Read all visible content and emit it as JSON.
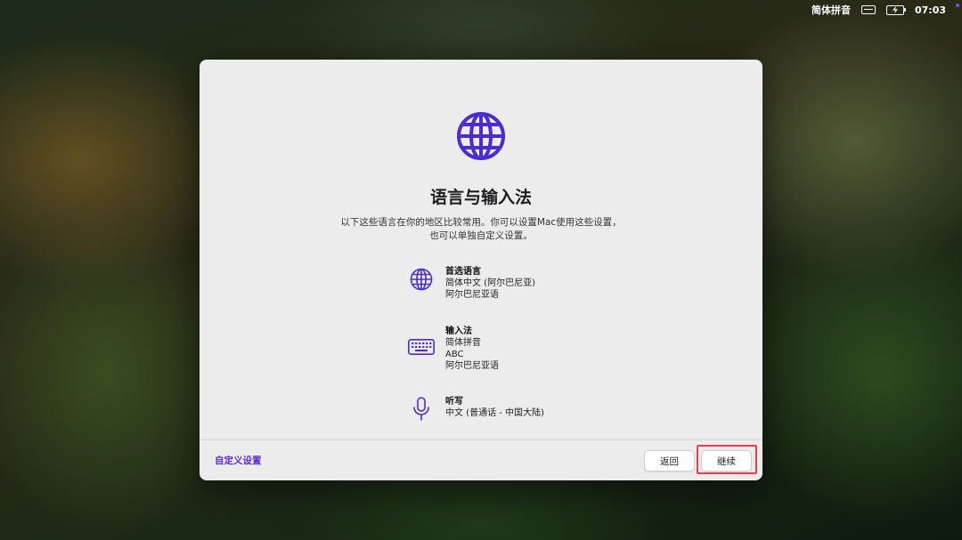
{
  "menubar": {
    "input_method": "简体拼音",
    "clock": "07:03"
  },
  "dialog": {
    "title": "语言与输入法",
    "description_line1": "以下这些语言在你的地区比较常用。你可以设置Mac使用这些设置，",
    "description_line2": "也可以单独自定义设置。",
    "sections": [
      {
        "icon": "globe-icon",
        "title": "首选语言",
        "lines": [
          "简体中文 (阿尔巴尼亚)",
          "阿尔巴尼亚语"
        ]
      },
      {
        "icon": "keyboard-icon",
        "title": "输入法",
        "lines": [
          "简体拼音",
          "ABC",
          "阿尔巴尼亚语"
        ]
      },
      {
        "icon": "microphone-icon",
        "title": "听写",
        "lines": [
          "中文 (普通话 - 中国大陆)"
        ]
      }
    ],
    "customize_link": "自定义设置",
    "back_button": "返回",
    "continue_button": "继续",
    "accent_color": "#5b2fd6",
    "highlight_color": "#e2404a"
  }
}
